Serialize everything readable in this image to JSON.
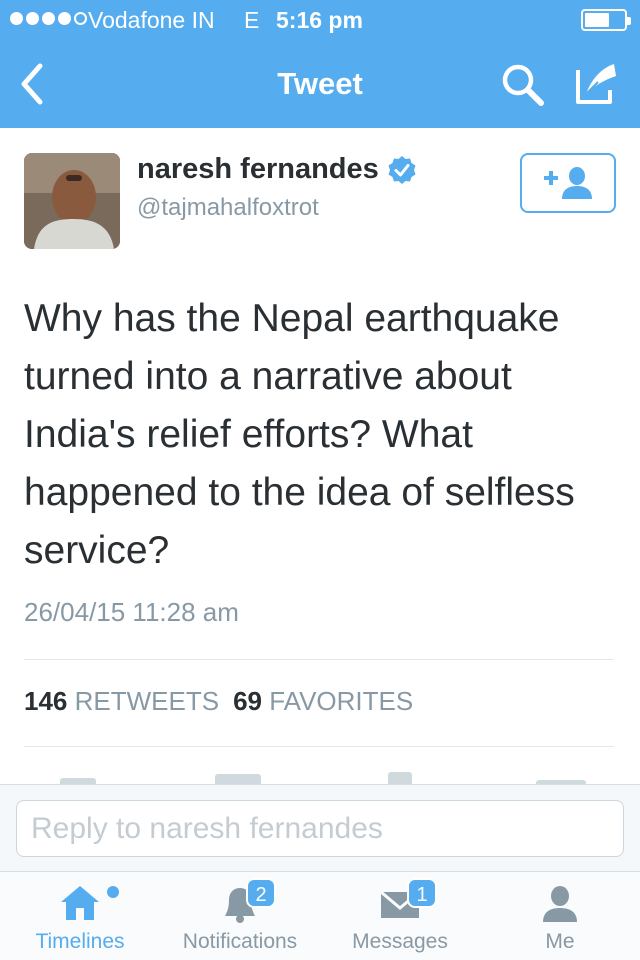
{
  "status_bar": {
    "carrier": "Vodafone IN",
    "network": "E",
    "time": "5:16 pm"
  },
  "nav": {
    "title": "Tweet",
    "back_icon": "chevron-left-icon",
    "search_icon": "search-icon",
    "compose_icon": "compose-icon"
  },
  "tweet": {
    "author_name": "naresh fernandes",
    "author_handle": "@tajmahalfoxtrot",
    "verified": true,
    "text": "Why has the Nepal earthquake turned into a narrative about India's relief efforts? What happened to the idea of selfless service?",
    "timestamp": "26/04/15 11:28 am",
    "retweets_count": "146",
    "retweets_label": "RETWEETS",
    "favorites_count": "69",
    "favorites_label": "FAVORITES"
  },
  "reply": {
    "placeholder": "Reply to naresh fernandes"
  },
  "tabbar": {
    "tabs": [
      {
        "label": "Timelines",
        "icon": "home-icon",
        "active": true,
        "badge": ""
      },
      {
        "label": "Notifications",
        "icon": "bell-icon",
        "active": false,
        "badge": "2"
      },
      {
        "label": "Messages",
        "icon": "envelope-icon",
        "active": false,
        "badge": "1"
      },
      {
        "label": "Me",
        "icon": "person-icon",
        "active": false,
        "badge": ""
      }
    ]
  },
  "colors": {
    "brand": "#55acee",
    "text": "#292f33",
    "muted": "#8899a6"
  }
}
